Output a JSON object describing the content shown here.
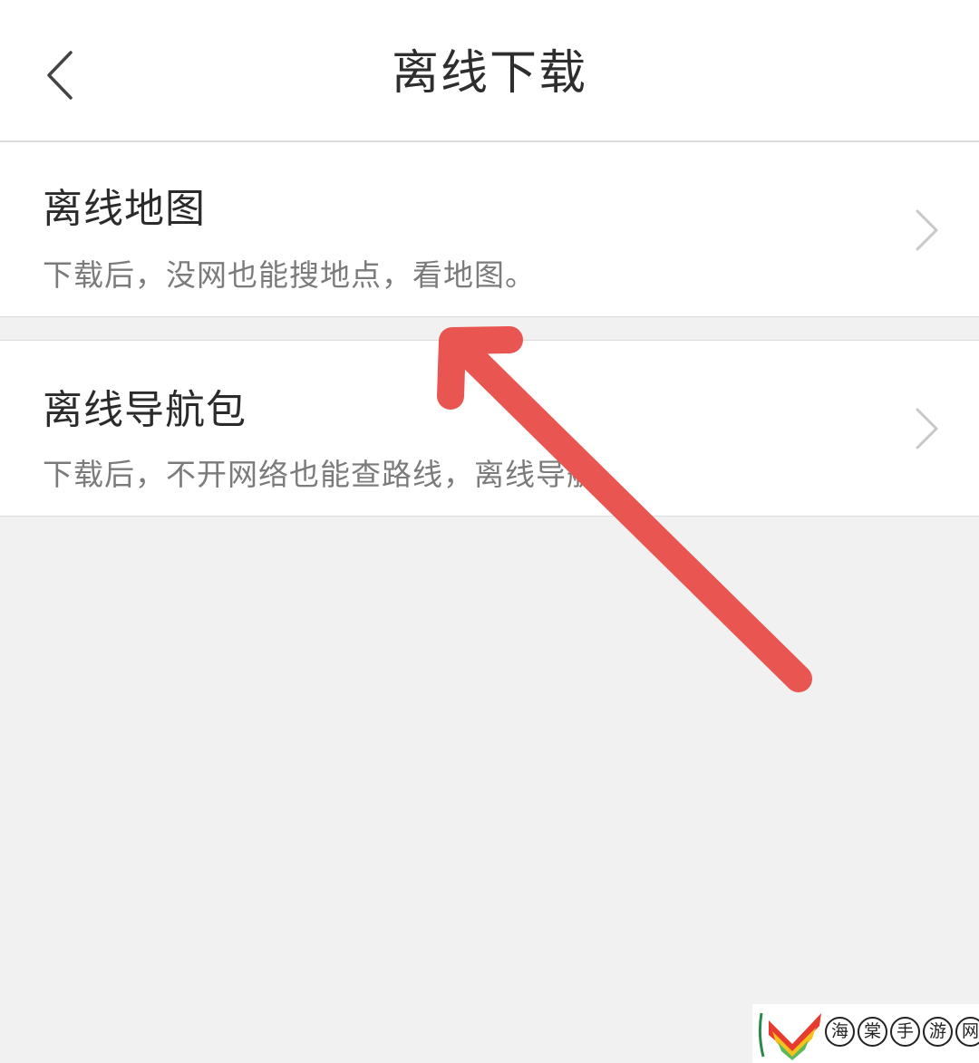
{
  "header": {
    "title": "离线下载",
    "back_icon": "chevron-left-icon"
  },
  "list": [
    {
      "title": "离线地图",
      "description": "下载后，没网也能搜地点，看地图。",
      "chevron_icon": "chevron-right-icon"
    },
    {
      "title": "离线导航包",
      "description": "下载后，不开网络也能查路线，离线导航。",
      "chevron_icon": "chevron-right-icon"
    }
  ],
  "annotation": {
    "arrow_color": "#e95551",
    "arrow_icon": "red-arrow-annotation"
  },
  "watermark": {
    "chars": [
      "海",
      "棠",
      "手",
      "游",
      "网"
    ]
  },
  "colors": {
    "background": "#f1f1f1",
    "surface": "#ffffff",
    "divider": "#dcdcdc",
    "title_text": "#2b2b2b",
    "desc_text": "#7b7b7b",
    "chevron": "#c8c8c8"
  }
}
